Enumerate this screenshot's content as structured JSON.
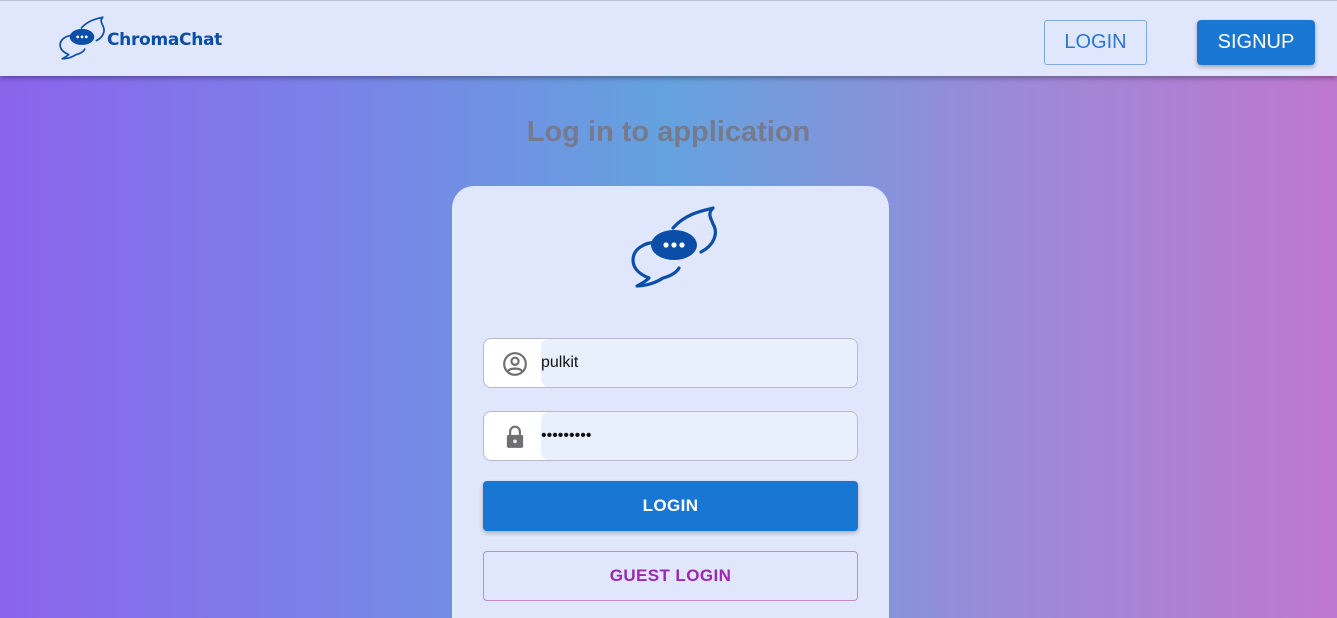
{
  "navbar": {
    "brand_name": "ChromaChat",
    "brand_logo_icon": "chat-bubbles-icon",
    "login_label": "LOGIN",
    "signup_label": "SIGNUP"
  },
  "page": {
    "title": "Log in to application"
  },
  "login_form": {
    "logo_icon": "chat-bubbles-icon",
    "username": {
      "icon": "user-circle-icon",
      "value": "pulkit"
    },
    "password": {
      "icon": "lock-icon",
      "value": "pulkit123"
    },
    "login_button_label": "LOGIN",
    "guest_login_button_label": "GUEST LOGIN"
  },
  "colors": {
    "primary": "#1976d2",
    "brand": "#0a4ea8",
    "secondary": "#9c27b0",
    "navbar_bg": "#e0e6fc",
    "card_bg": "#e0e6fc"
  }
}
